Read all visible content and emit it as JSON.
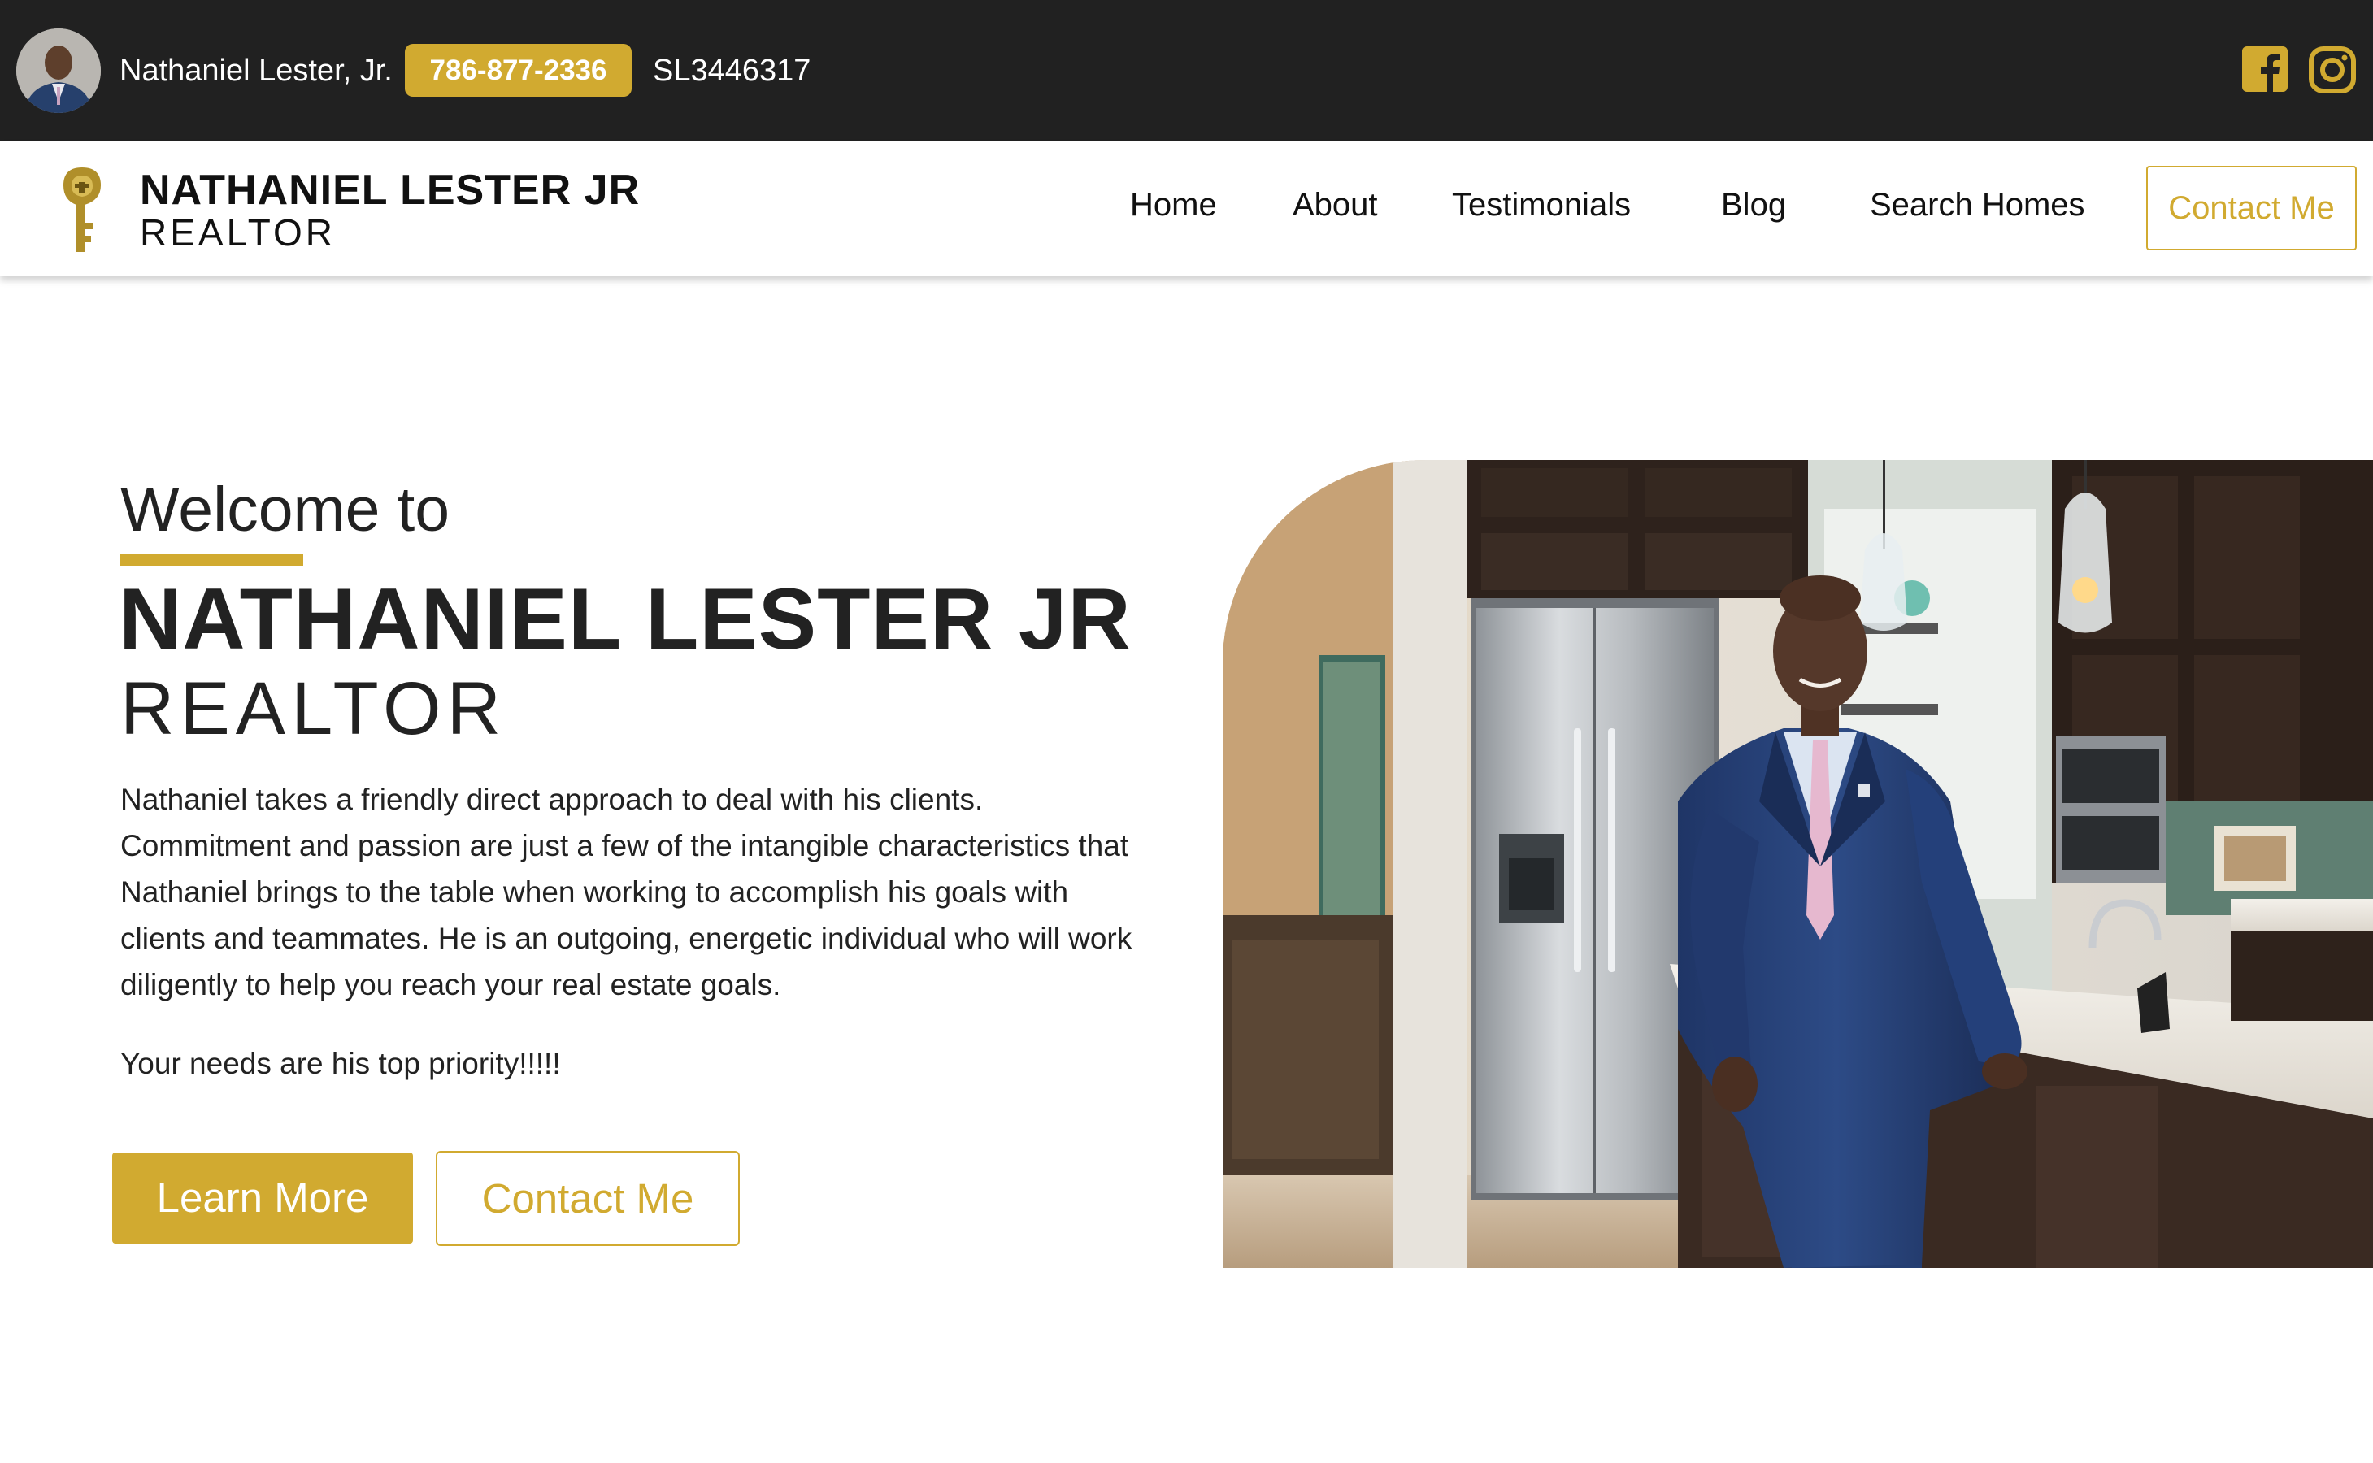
{
  "topbar": {
    "agent_name": "Nathaniel Lester, Jr.",
    "phone": "786-877-2336",
    "license": "SL3446317",
    "social": [
      "facebook-icon",
      "instagram-icon"
    ]
  },
  "header": {
    "logo_line1": "NATHANIEL LESTER JR",
    "logo_line2": "REALTOR",
    "nav": {
      "home": "Home",
      "about": "About",
      "testimonials": "Testimonials",
      "blog": "Blog",
      "search": "Search Homes",
      "contact": "Contact Me"
    }
  },
  "hero": {
    "welcome": "Welcome to",
    "name": "NATHANIEL LESTER JR",
    "role": "REALTOR",
    "description": "Nathaniel takes a friendly direct approach to deal with his clients. Commitment and passion are just a few of the intangible characteristics that Nathaniel brings to the table when working to accomplish his goals with clients and teammates. He is an outgoing, energetic individual who will work diligently to help you reach your real estate goals.",
    "priority": "Your needs are his top priority!!!!!",
    "learn_more": "Learn More",
    "contact_me": "Contact Me"
  },
  "colors": {
    "accent": "#d1aa30",
    "topbar_bg": "#212121",
    "text": "#222222"
  }
}
